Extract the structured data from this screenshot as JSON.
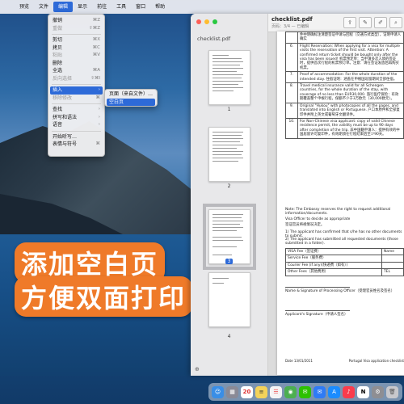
{
  "menubar": {
    "apple": "",
    "items": [
      "预览",
      "文件",
      "编辑",
      "显示",
      "前往",
      "工具",
      "窗口",
      "帮助"
    ],
    "active_index": 2
  },
  "edit_menu": {
    "items": [
      {
        "label": "撤销",
        "shortcut": "⌘Z"
      },
      {
        "label": "重做",
        "shortcut": "⇧⌘Z",
        "disabled": true
      },
      {
        "label": "剪切",
        "shortcut": "⌘X"
      },
      {
        "label": "拷贝",
        "shortcut": "⌘C"
      },
      {
        "label": "粘贴",
        "shortcut": "⌘V",
        "disabled": true
      },
      {
        "label": "删除",
        "shortcut": ""
      },
      {
        "label": "全选",
        "shortcut": "⌘A"
      },
      {
        "label": "反向选择",
        "shortcut": "⇧⌘I",
        "disabled": true
      },
      {
        "label": "插入",
        "shortcut": "›"
      },
      {
        "label": "移除修改",
        "shortcut": "⌘",
        "disabled": true
      },
      {
        "label": "查找",
        "shortcut": "›"
      },
      {
        "label": "拼写和语法",
        "shortcut": "›"
      },
      {
        "label": "语音",
        "shortcut": "›"
      },
      {
        "label": "开始听写…",
        "shortcut": ""
      },
      {
        "label": "表情与符号",
        "shortcut": "⌘"
      }
    ]
  },
  "insert_submenu": {
    "items": [
      "页面（来自文件）…",
      "空白页"
    ]
  },
  "overlay": {
    "line1": "添加空白页",
    "line2": "方便双面打印"
  },
  "sidebar": {
    "title": "checklist.pdf",
    "pages": [
      "1",
      "2",
      "3",
      "4"
    ],
    "selected_page": "3"
  },
  "document": {
    "title": "checklist.pdf",
    "subtitle": "页码：3/4 — 已编辑",
    "table_rows": [
      {
        "num": "",
        "text": "件中明确标注清楚签证申请与回程（交通方式类型），证明申请人确实"
      },
      {
        "num": "6.",
        "text": "Flight Reservation: When applying for a visa for multiple visits the reservation of the first visit. Attention: A confirmed return ticket should be bought only after the visa has been issued! 机票预定单：当申请多次入境的签证时，提供首次行程的机票预订单。注意：请在签证发放后再购买机票。"
      },
      {
        "num": "7.",
        "text": "Proof of accommodation: For the whole duration of the intended stay. 住宿证明：涵盖在申根国逗留期间全部住宿。"
      },
      {
        "num": "8.",
        "text": "Travel medical insurance valid for all Schengen countries, for the whole duration of the stay, with coverage of no less than EUR30,000. 旅行医疗保险：有效期覆盖整个申根行程，保额不少于3万欧元（30,000欧元）。"
      },
      {
        "num": "9.",
        "text": "Original \"Hukou\" with photocopies of all the pages, and translated into English or Portuguese. 户口本原件和全部复印件并附上英文或葡萄牙文翻译件。"
      },
      {
        "num": "10.",
        "text": "For Non-Chinese visa applicant: copy of valid Chinese residence permit, the validity must be up to 90 days after completion of the trip. 非中国籍申请人：提供有效的中国居留许可复印件，有效期须在行程结束后至少90天。"
      }
    ],
    "notes": [
      "Note: The Embassy reserves the right to request additional information/documents.",
      "Visa Officer to decide as appropriate",
      "签证官员将视情况决定。",
      "1) The applicant has confirmed that s/he has no other documents to submit.",
      "2) The applicant has submitted all requested documents (those submitted in a folder)."
    ],
    "fees_headers": [
      "VISA Fee（签证费）",
      "Name"
    ],
    "fees_rows": [
      [
        "Service Fee（服务费）",
        ""
      ],
      [
        "Courier Fee (if any)(快递费（如有）)",
        ""
      ],
      [
        "Other Fees（其他费用）",
        "TEL"
      ]
    ],
    "signatures": [
      "Name & Signature of Processing Officer（受理官员姓名及签名）",
      "Applicant's Signature（申请人签名）"
    ],
    "footer_left": "Date 13/01/2011",
    "footer_right": "Portugal Visa application checklist"
  },
  "dock": {
    "calendar_day": "20",
    "icons": [
      "finder-icon",
      "launchpad-icon",
      "calendar-icon",
      "notes-icon",
      "reminders-icon",
      "chrome-icon",
      "wechat-icon",
      "mail-icon",
      "app-store-icon",
      "music-icon",
      "notion-icon",
      "settings-icon",
      "trash-icon"
    ]
  },
  "colors": {
    "accent": "#2d6ad8",
    "overlay_bg": "#ef7a29"
  }
}
